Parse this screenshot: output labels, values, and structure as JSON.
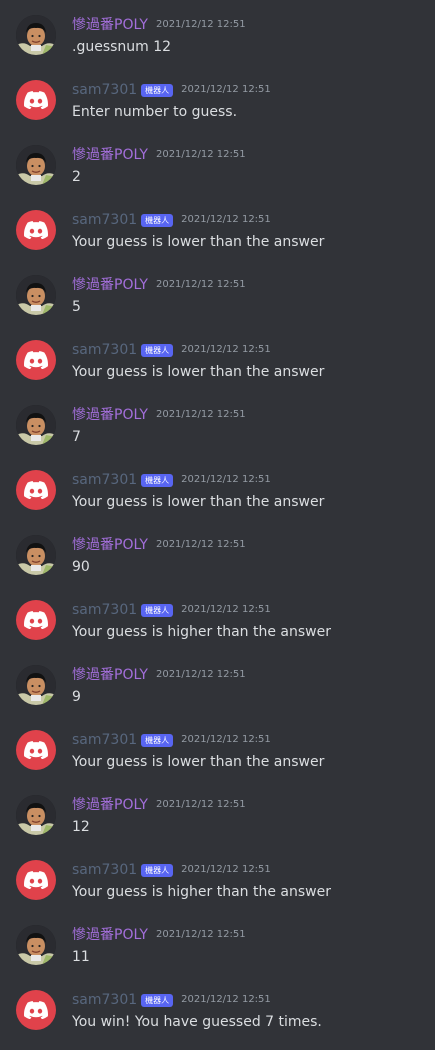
{
  "channel": {
    "messages": [
      {
        "author": "慘過番POLY",
        "kind": "user",
        "time": "2021/12/12 12:51",
        "text": ".guessnum 12"
      },
      {
        "author": "sam7301",
        "kind": "bot",
        "badge": "機器人",
        "time": "2021/12/12 12:51",
        "text": "Enter number to guess."
      },
      {
        "author": "慘過番POLY",
        "kind": "user",
        "time": "2021/12/12 12:51",
        "text": "2"
      },
      {
        "author": "sam7301",
        "kind": "bot",
        "badge": "機器人",
        "time": "2021/12/12 12:51",
        "text": "Your guess is lower than the answer"
      },
      {
        "author": "慘過番POLY",
        "kind": "user",
        "time": "2021/12/12 12:51",
        "text": "5"
      },
      {
        "author": "sam7301",
        "kind": "bot",
        "badge": "機器人",
        "time": "2021/12/12 12:51",
        "text": "Your guess is lower than the answer"
      },
      {
        "author": "慘過番POLY",
        "kind": "user",
        "time": "2021/12/12 12:51",
        "text": "7"
      },
      {
        "author": "sam7301",
        "kind": "bot",
        "badge": "機器人",
        "time": "2021/12/12 12:51",
        "text": "Your guess is lower than the answer"
      },
      {
        "author": "慘過番POLY",
        "kind": "user",
        "time": "2021/12/12 12:51",
        "text": "90"
      },
      {
        "author": "sam7301",
        "kind": "bot",
        "badge": "機器人",
        "time": "2021/12/12 12:51",
        "text": "Your guess is higher than the answer"
      },
      {
        "author": "慘過番POLY",
        "kind": "user",
        "time": "2021/12/12 12:51",
        "text": "9"
      },
      {
        "author": "sam7301",
        "kind": "bot",
        "badge": "機器人",
        "time": "2021/12/12 12:51",
        "text": "Your guess is lower than the answer"
      },
      {
        "author": "慘過番POLY",
        "kind": "user",
        "time": "2021/12/12 12:51",
        "text": "12"
      },
      {
        "author": "sam7301",
        "kind": "bot",
        "badge": "機器人",
        "time": "2021/12/12 12:51",
        "text": "Your guess is higher than the answer"
      },
      {
        "author": "慘過番POLY",
        "kind": "user",
        "time": "2021/12/12 12:51",
        "text": "11"
      },
      {
        "author": "sam7301",
        "kind": "bot",
        "badge": "機器人",
        "time": "2021/12/12 12:51",
        "text": "You win! You have guessed 7 times."
      }
    ]
  },
  "colors": {
    "background": "#313338",
    "user_name": "#a46fdc",
    "bot_name": "#58677e",
    "bot_badge": "#5865f2",
    "bot_avatar": "#e0424b",
    "timestamp": "#949ba4",
    "message_text": "#dbdee1"
  },
  "icons": {
    "bot_avatar": "discord-logo-icon",
    "user_avatar": "user-photo-avatar"
  }
}
